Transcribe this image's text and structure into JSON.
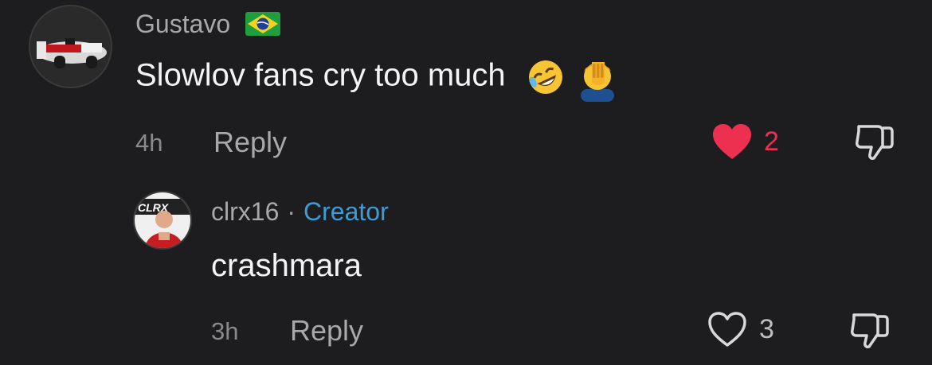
{
  "comments": [
    {
      "username": "Gustavo",
      "flag": "brazil-flag-icon",
      "text": "Slowlov fans cry too much",
      "emojis": [
        "rolling-on-floor-laughing-emoji",
        "face-palm-emoji"
      ],
      "time": "4h",
      "reply_label": "Reply",
      "likes": "2",
      "liked": true
    }
  ],
  "reply": {
    "username": "clrx16",
    "separator": "·",
    "badge": "Creator",
    "text": "crashmara",
    "time": "3h",
    "reply_label": "Reply",
    "likes": "3",
    "liked": false
  },
  "colors": {
    "background": "#1d1d1f",
    "liked_heart": "#ee3050",
    "creator": "#3d9bd6",
    "muted": "#a8a8a8"
  }
}
